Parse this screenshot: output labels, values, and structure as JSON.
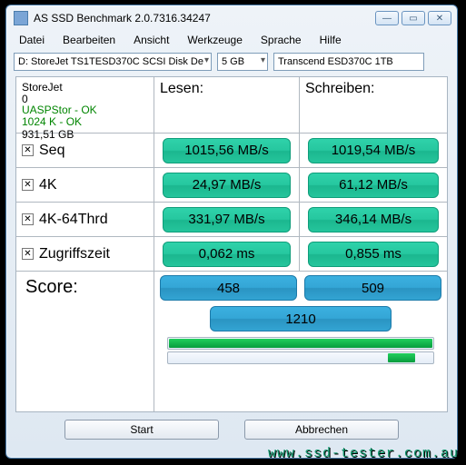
{
  "window": {
    "title": "AS SSD Benchmark 2.0.7316.34247"
  },
  "menu": {
    "datei": "Datei",
    "bearbeiten": "Bearbeiten",
    "ansicht": "Ansicht",
    "werkzeuge": "Werkzeuge",
    "sprache": "Sprache",
    "hilfe": "Hilfe"
  },
  "toolbar": {
    "drive": "D: StoreJet TS1TESD370C SCSI Disk De",
    "size": "5 GB",
    "device": "Transcend ESD370C 1TB"
  },
  "info": {
    "name": "StoreJet",
    "sub": "0",
    "uasp": "UASPStor - OK",
    "align": "1024 K - OK",
    "capacity": "931,51 GB"
  },
  "headers": {
    "read": "Lesen:",
    "write": "Schreiben:"
  },
  "tests": {
    "seq": {
      "label": "Seq",
      "read": "1015,56 MB/s",
      "write": "1019,54 MB/s"
    },
    "r4k": {
      "label": "4K",
      "read": "24,97 MB/s",
      "write": "61,12 MB/s"
    },
    "r4k64": {
      "label": "4K-64Thrd",
      "read": "331,97 MB/s",
      "write": "346,14 MB/s"
    },
    "acc": {
      "label": "Zugriffszeit",
      "read": "0,062 ms",
      "write": "0,855 ms"
    }
  },
  "score": {
    "label": "Score:",
    "read": "458",
    "write": "509",
    "total": "1210"
  },
  "buttons": {
    "start": "Start",
    "abort": "Abbrechen"
  },
  "watermark": "www.ssd-tester.com.au"
}
